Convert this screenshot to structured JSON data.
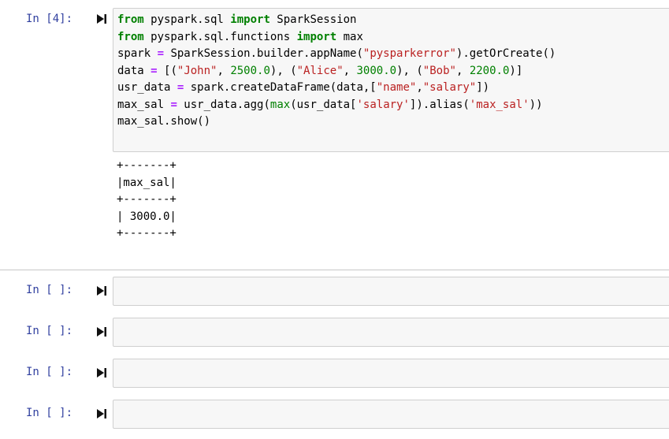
{
  "cells": [
    {
      "prompt": "In [4]:",
      "code": {
        "line1": {
          "t1": "from",
          "t2": " pyspark.sql ",
          "t3": "import",
          "t4": " SparkSession"
        },
        "line2": {
          "t1": "from",
          "t2": " pyspark.sql.functions ",
          "t3": "import",
          "t4": " max"
        },
        "line3": {
          "t1": "spark ",
          "t2": "=",
          "t3": " SparkSession.builder.appName(",
          "t4": "\"pysparkerror\"",
          "t5": ").getOrCreate()"
        },
        "line4": {
          "t1": "data ",
          "t2": "=",
          "t3": " [(",
          "s1": "\"John\"",
          "c1": ", ",
          "n1": "2500.0",
          "p1": "), (",
          "s2": "\"Alice\"",
          "c2": ", ",
          "n2": "3000.0",
          "p2": "), (",
          "s3": "\"Bob\"",
          "c3": ", ",
          "n3": "2200.0",
          "p3": ")]"
        },
        "line5": {
          "t1": "usr_data ",
          "t2": "=",
          "t3": " spark.createDataFrame(data,[",
          "s1": "\"name\"",
          "c1": ",",
          "s2": "\"salary\"",
          "t4": "])"
        },
        "line6": {
          "t1": "max_sal ",
          "t2": "=",
          "t3": " usr_data.agg(",
          "b1": "max",
          "t4": "(usr_data[",
          "s1": "'salary'",
          "t5": "]).alias(",
          "s2": "'max_sal'",
          "t6": "))"
        },
        "line7": {
          "t1": "max_sal.show()"
        }
      },
      "output": "+-------+\n|max_sal|\n+-------+\n| 3000.0|\n+-------+"
    },
    {
      "prompt": "In [ ]:"
    },
    {
      "prompt": "In [ ]:"
    },
    {
      "prompt": "In [ ]:"
    },
    {
      "prompt": "In [ ]:"
    }
  ],
  "icons": {
    "run": "run-cell-icon"
  }
}
